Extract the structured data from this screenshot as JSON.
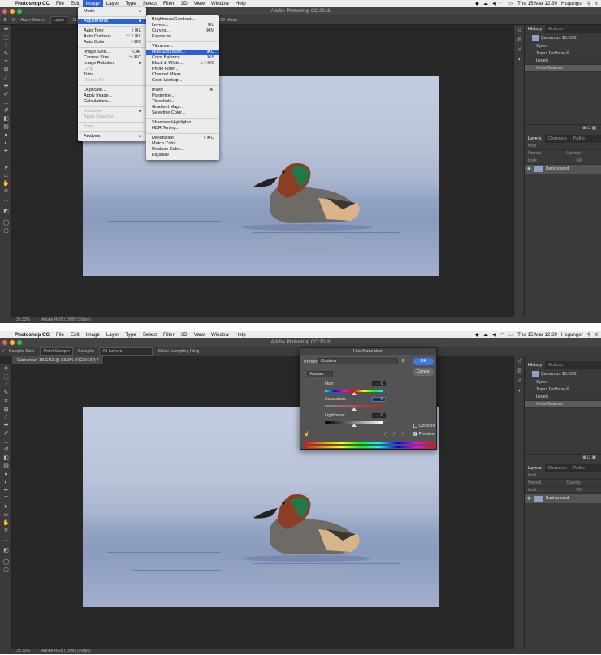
{
  "menubar": {
    "app": "Photoshop CC",
    "items": [
      "File",
      "Edit",
      "Image",
      "Layer",
      "Type",
      "Select",
      "Filter",
      "3D",
      "View",
      "Window",
      "Help"
    ],
    "active_item": "Image",
    "clock": "Thu 15 Mar  12:39",
    "user": "Hcgungor"
  },
  "window": {
    "title": "Adobe Photoshop CC 2018"
  },
  "doc_tab": "Çamurcun 18.CR2 @ 33.3% (RGB/16*) *",
  "status": {
    "zoom": "33.33%",
    "profile": "Adobe RGB (1998) (16bpc)"
  },
  "top_options": {
    "auto_select_label": "Auto-Select:",
    "auto_select_value": "Layer",
    "show_label": "Sh",
    "mode_label": "3D Mode:"
  },
  "bottom_options": {
    "sample_size_label": "Sample Size:",
    "sample_size_value": "Point Sample",
    "sample_label": "Sample:",
    "sample_value": "All Layers",
    "sampling_ring": "Show Sampling Ring"
  },
  "image_menu": [
    {
      "label": "Mode",
      "arrow": true
    },
    {
      "sep": true
    },
    {
      "label": "Adjustments",
      "arrow": true,
      "highlight": true
    },
    {
      "sep": true
    },
    {
      "label": "Auto Tone",
      "shortcut": "⇧⌘L"
    },
    {
      "label": "Auto Contrast",
      "shortcut": "⌥⇧⌘L"
    },
    {
      "label": "Auto Color",
      "shortcut": "⇧⌘B"
    },
    {
      "sep": true
    },
    {
      "label": "Image Size...",
      "shortcut": "⌥⌘I"
    },
    {
      "label": "Canvas Size...",
      "shortcut": "⌥⌘C"
    },
    {
      "label": "Image Rotation",
      "arrow": true
    },
    {
      "label": "Crop",
      "disabled": true
    },
    {
      "label": "Trim..."
    },
    {
      "label": "Reveal All",
      "disabled": true
    },
    {
      "sep": true
    },
    {
      "label": "Duplicate..."
    },
    {
      "label": "Apply Image..."
    },
    {
      "label": "Calculations..."
    },
    {
      "sep": true
    },
    {
      "label": "Variables",
      "arrow": true,
      "disabled": true
    },
    {
      "label": "Apply Data Set...",
      "disabled": true
    },
    {
      "sep": true
    },
    {
      "label": "Trap...",
      "disabled": true
    },
    {
      "sep": true
    },
    {
      "label": "Analysis",
      "arrow": true
    }
  ],
  "adjustments_menu": [
    {
      "label": "Brightness/Contrast..."
    },
    {
      "label": "Levels...",
      "shortcut": "⌘L"
    },
    {
      "label": "Curves...",
      "shortcut": "⌘M"
    },
    {
      "label": "Exposure..."
    },
    {
      "sep": true
    },
    {
      "label": "Vibrance..."
    },
    {
      "label": "Hue/Saturation...",
      "shortcut": "⌘U",
      "highlight": true
    },
    {
      "label": "Color Balance...",
      "shortcut": "⌘B"
    },
    {
      "label": "Black & White...",
      "shortcut": "⌥⇧⌘B"
    },
    {
      "label": "Photo Filter..."
    },
    {
      "label": "Channel Mixer..."
    },
    {
      "label": "Color Lookup..."
    },
    {
      "sep": true
    },
    {
      "label": "Invert",
      "shortcut": "⌘I"
    },
    {
      "label": "Posterize..."
    },
    {
      "label": "Threshold..."
    },
    {
      "label": "Gradient Map..."
    },
    {
      "label": "Selective Color..."
    },
    {
      "sep": true
    },
    {
      "label": "Shadows/Highlights..."
    },
    {
      "label": "HDR Toning..."
    },
    {
      "sep": true
    },
    {
      "label": "Desaturate",
      "shortcut": "⇧⌘U"
    },
    {
      "label": "Match Color..."
    },
    {
      "label": "Replace Color..."
    },
    {
      "label": "Equalize"
    }
  ],
  "history": {
    "tabs": [
      "History",
      "Actions"
    ],
    "snapshot": "Çamurcun 18.CR2",
    "items": [
      "Open",
      "Topaz DeNoise 6",
      "Levels",
      "Color Balance"
    ],
    "selected": "Color Balance"
  },
  "layers": {
    "tabs": [
      "Layers",
      "Channels",
      "Paths"
    ],
    "kind": "Kind",
    "blend": "Normal",
    "opacity_label": "Opacity:",
    "lock_label": "Lock:",
    "fill_label": "Fill:",
    "layer_name": "Background"
  },
  "hue_sat": {
    "title": "Hue/Saturation",
    "preset_label": "Preset:",
    "preset_value": "Custom",
    "channel": "Master",
    "hue_label": "Hue:",
    "hue_value": "0",
    "saturation_label": "Saturation:",
    "saturation_value": "0",
    "lightness_label": "Lightness:",
    "lightness_value": "0",
    "colorize_label": "Colorize",
    "colorize_checked": false,
    "preview_label": "Preview",
    "preview_checked": true,
    "ok_label": "OK",
    "cancel_label": "Cancel"
  },
  "colors": {
    "accent": "#2a62d6",
    "ok_button": "#3b7ae6"
  }
}
